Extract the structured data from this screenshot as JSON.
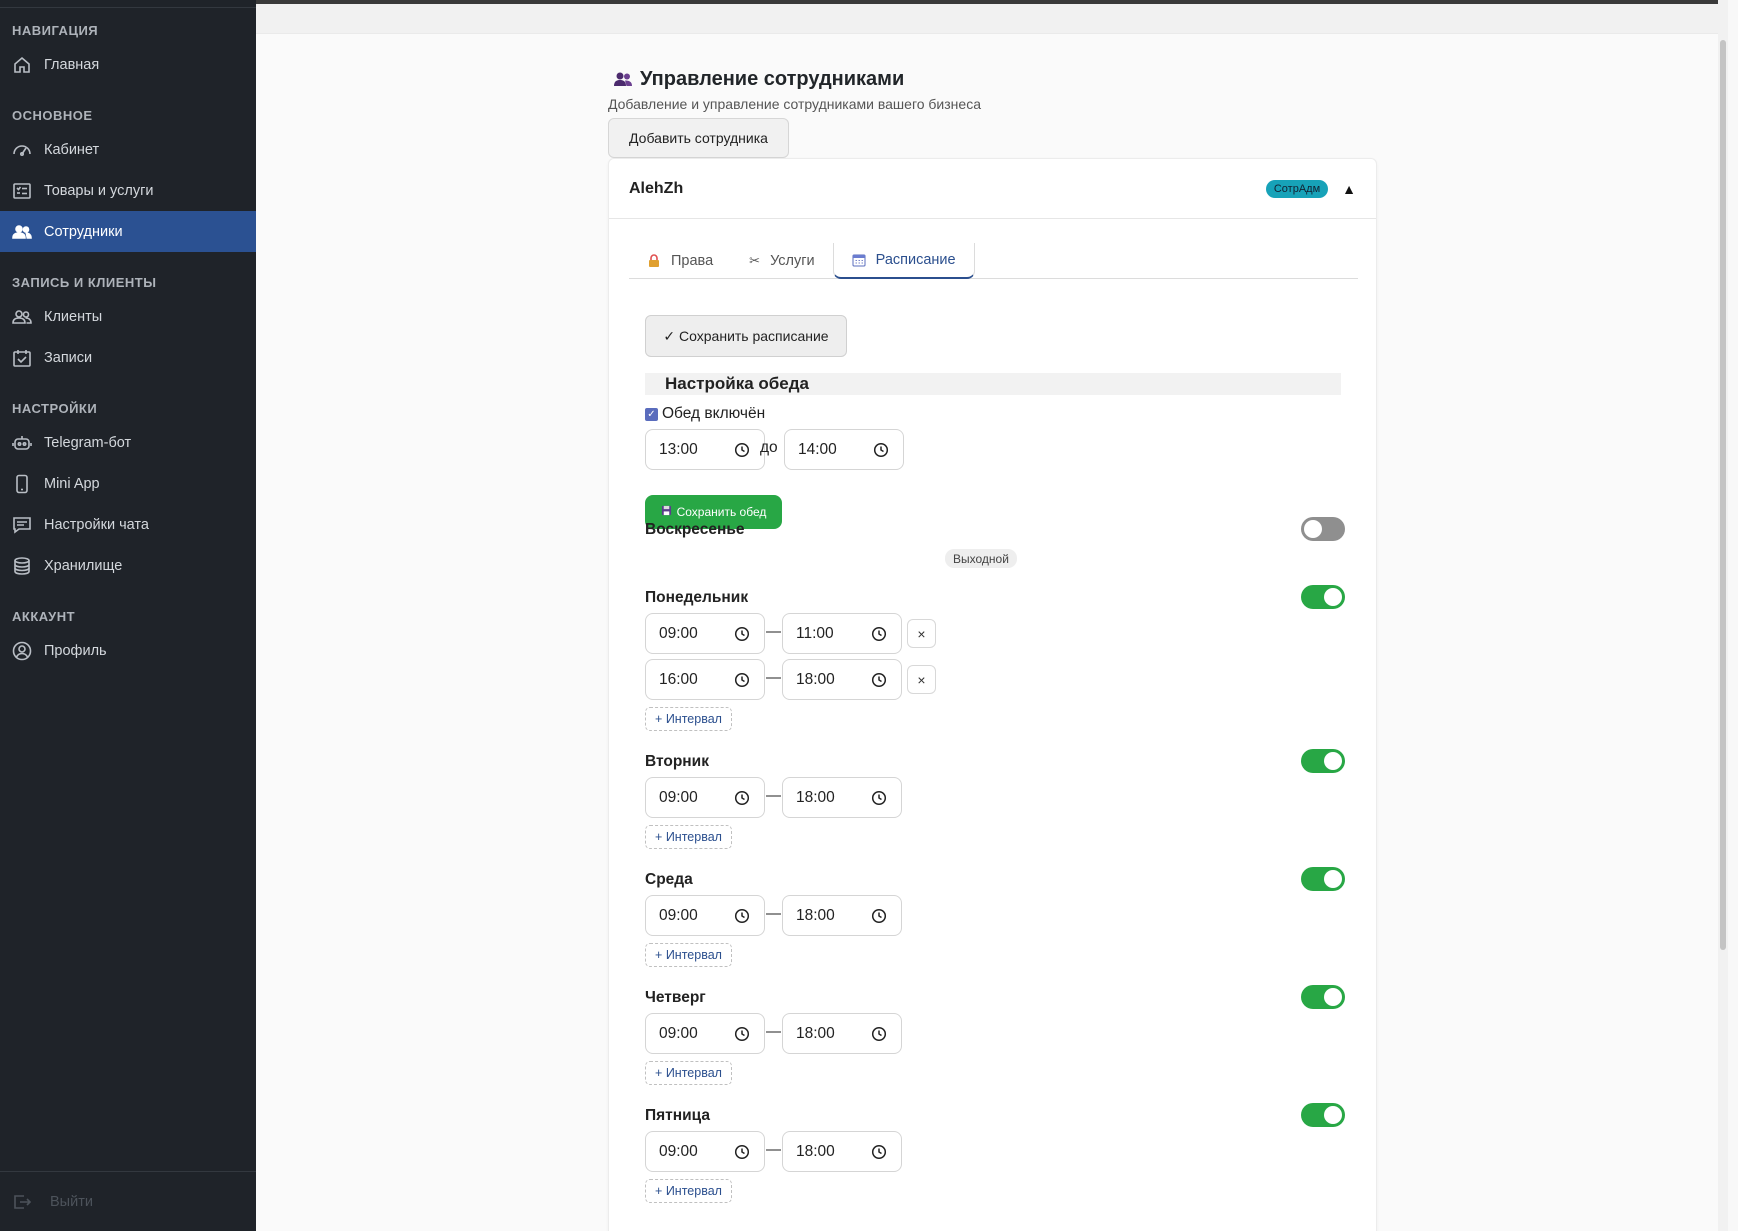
{
  "sidebar": {
    "sections": [
      {
        "title": "НАВИГАЦИЯ",
        "items": [
          {
            "label": "Главная",
            "icon": "home-icon"
          }
        ]
      },
      {
        "title": "ОСНОВНОЕ",
        "items": [
          {
            "label": "Кабинет",
            "icon": "dashboard-icon"
          },
          {
            "label": "Товары и услуги",
            "icon": "list-icon"
          },
          {
            "label": "Сотрудники",
            "icon": "people-icon",
            "active": true
          }
        ]
      },
      {
        "title": "ЗАПИСЬ И КЛИЕНТЫ",
        "items": [
          {
            "label": "Клиенты",
            "icon": "clients-icon"
          },
          {
            "label": "Записи",
            "icon": "calendar-check-icon"
          }
        ]
      },
      {
        "title": "НАСТРОЙКИ",
        "items": [
          {
            "label": "Telegram-бот",
            "icon": "robot-icon"
          },
          {
            "label": "Mini App",
            "icon": "phone-icon"
          },
          {
            "label": "Настройки чата",
            "icon": "chat-icon"
          },
          {
            "label": "Хранилище",
            "icon": "database-icon"
          }
        ]
      },
      {
        "title": "АККАУНТ",
        "items": [
          {
            "label": "Профиль",
            "icon": "profile-icon"
          }
        ]
      }
    ],
    "logout_label": "Выйти"
  },
  "page": {
    "title": "Управление сотрудниками",
    "subtitle": "Добавление и управление сотрудниками вашего бизнеса",
    "add_button": "Добавить сотрудника"
  },
  "employee": {
    "name": "AlehZh",
    "badge": "СотрАдм",
    "caret": "▲"
  },
  "tabs": [
    {
      "label": "Права",
      "icon": "lock-icon"
    },
    {
      "label": "Услуги",
      "icon": "scissors-icon"
    },
    {
      "label": "Расписание",
      "icon": "calendar-icon",
      "active": true
    }
  ],
  "schedule": {
    "save_button": "✓ Сохранить расписание",
    "lunch_title": "Настройка обеда",
    "lunch_enabled_label": "Обед включён",
    "lunch_from": "13:00",
    "lunch_to_word": "до",
    "lunch_to": "14:00",
    "save_lunch_button": "Сохранить обед",
    "day_off_label": "Выходной",
    "add_interval_label": "+ Интервал",
    "days": [
      {
        "name": "Воскресенье",
        "enabled": false,
        "intervals": []
      },
      {
        "name": "Понедельник",
        "enabled": true,
        "intervals": [
          [
            "09:00",
            "11:00"
          ],
          [
            "16:00",
            "18:00"
          ]
        ]
      },
      {
        "name": "Вторник",
        "enabled": true,
        "intervals": [
          [
            "09:00",
            "18:00"
          ]
        ]
      },
      {
        "name": "Среда",
        "enabled": true,
        "intervals": [
          [
            "09:00",
            "18:00"
          ]
        ]
      },
      {
        "name": "Четверг",
        "enabled": true,
        "intervals": [
          [
            "09:00",
            "18:00"
          ]
        ]
      },
      {
        "name": "Пятница",
        "enabled": true,
        "intervals": [
          [
            "09:00",
            "18:00"
          ]
        ]
      }
    ]
  }
}
